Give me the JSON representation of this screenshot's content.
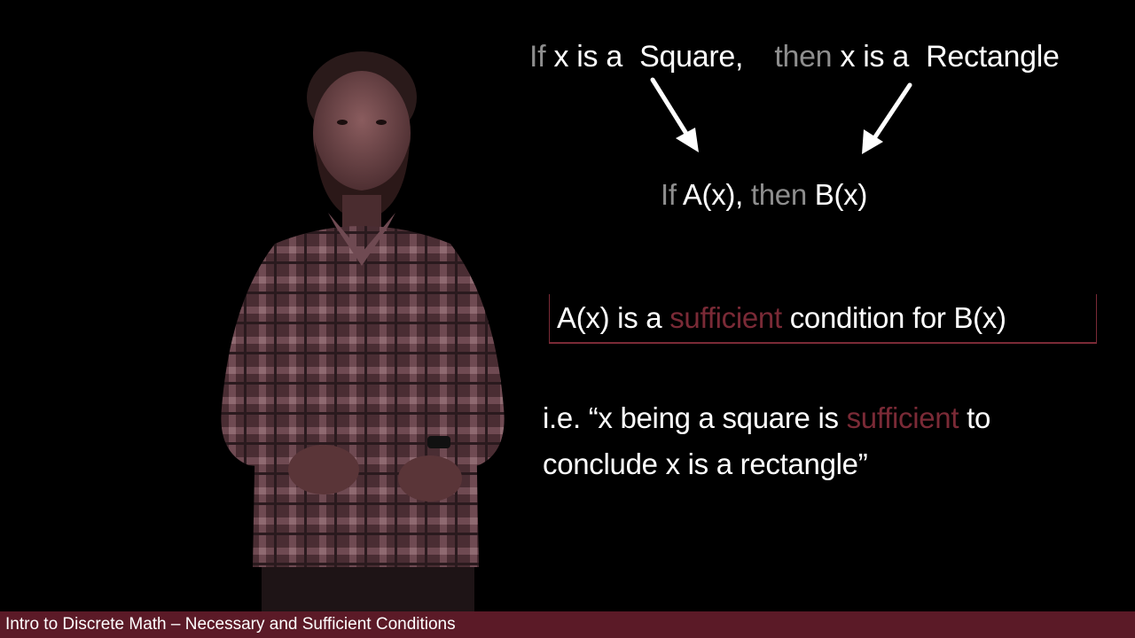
{
  "slide": {
    "top_statement": {
      "if": "If",
      "x1": "x is a",
      "square": "Square,",
      "then": "then",
      "x2": "x is a",
      "rectangle": "Rectangle"
    },
    "general_form": {
      "if": "If",
      "a": "A(x),",
      "then": "then",
      "b": "B(x)"
    },
    "boxed_statement": {
      "part1": "A(x) is a",
      "highlight": "sufficient",
      "part2": "condition for B(x)"
    },
    "explanation": {
      "line1_start": "i.e. “x being a square is",
      "line1_highlight": "sufficient",
      "line1_end": "to",
      "line2": "conclude x is a rectangle”"
    }
  },
  "caption": {
    "text": "Intro to Discrete Math – Necessary and Sufficient Conditions"
  },
  "colors": {
    "background": "#000000",
    "text": "#ffffff",
    "dim_text": "#8e8e8e",
    "accent": "#7a2a36",
    "caption_bar": "#5b1a27"
  }
}
